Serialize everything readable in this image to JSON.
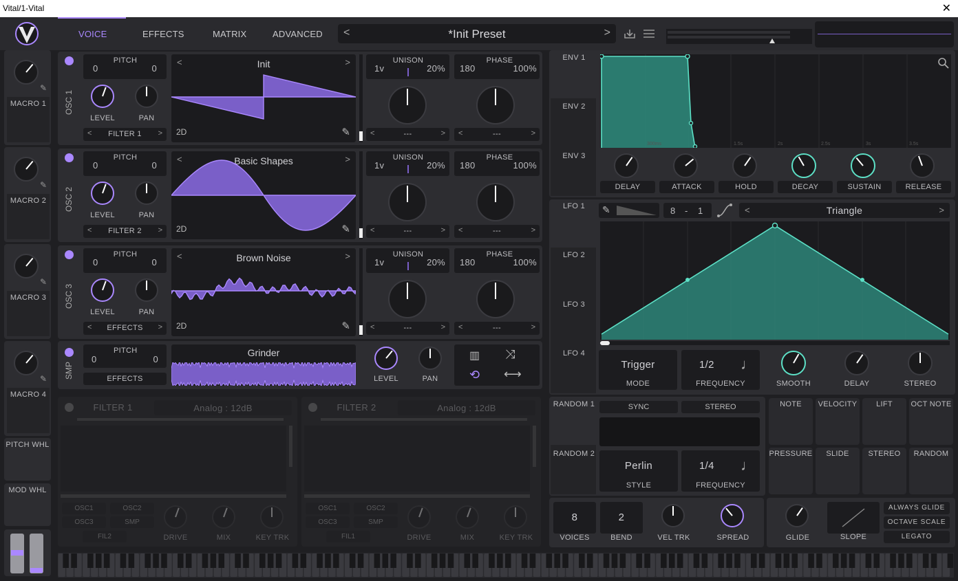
{
  "window": {
    "title": "Vital/1-Vital",
    "close": "✕"
  },
  "tabs": [
    "VOICE",
    "EFFECTS",
    "MATRIX",
    "ADVANCED"
  ],
  "preset": {
    "name": "*Init Preset",
    "prev": "<",
    "next": ">"
  },
  "macros": [
    "MACRO 1",
    "MACRO 2",
    "MACRO 3",
    "MACRO 4"
  ],
  "wheels": [
    "PITCH WHL",
    "MOD WHL"
  ],
  "oscs": [
    {
      "title": "OSC 1",
      "pitch_label": "PITCH",
      "pitch_left": "0",
      "pitch_right": "0",
      "level": "LEVEL",
      "pan": "PAN",
      "route": "FILTER 1",
      "wave": "Init",
      "mode": "2D",
      "unison": "UNISON",
      "voices": "1v",
      "detune": "20%",
      "phase_lbl": "PHASE",
      "phase": "180",
      "rand": "100%",
      "sel_a": "---",
      "sel_b": "---"
    },
    {
      "title": "OSC 2",
      "pitch_label": "PITCH",
      "pitch_left": "0",
      "pitch_right": "0",
      "level": "LEVEL",
      "pan": "PAN",
      "route": "FILTER 2",
      "wave": "Basic Shapes",
      "mode": "2D",
      "unison": "UNISON",
      "voices": "1v",
      "detune": "20%",
      "phase_lbl": "PHASE",
      "phase": "180",
      "rand": "100%",
      "sel_a": "---",
      "sel_b": "---"
    },
    {
      "title": "OSC 3",
      "pitch_label": "PITCH",
      "pitch_left": "0",
      "pitch_right": "0",
      "level": "LEVEL",
      "pan": "PAN",
      "route": "EFFECTS",
      "wave": "Brown Noise",
      "mode": "2D",
      "unison": "UNISON",
      "voices": "1v",
      "detune": "20%",
      "phase_lbl": "PHASE",
      "phase": "180",
      "rand": "100%",
      "sel_a": "---",
      "sel_b": "---"
    }
  ],
  "smp": {
    "title": "SMP",
    "pitch_label": "PITCH",
    "pitch_left": "0",
    "pitch_right": "0",
    "route": "EFFECTS",
    "wave": "Grinder",
    "level": "LEVEL",
    "pan": "PAN"
  },
  "filters": [
    {
      "title": "FILTER 1",
      "type": "Analog : 12dB",
      "src": [
        "OSC1",
        "OSC2",
        "OSC3",
        "SMP",
        "FIL2"
      ],
      "drive": "DRIVE",
      "mix": "MIX",
      "keytrk": "KEY TRK"
    },
    {
      "title": "FILTER 2",
      "type": "Analog : 12dB",
      "src": [
        "OSC1",
        "OSC2",
        "OSC3",
        "SMP",
        "FIL1"
      ],
      "drive": "DRIVE",
      "mix": "MIX",
      "keytrk": "KEY TRK"
    }
  ],
  "envs": [
    "ENV 1",
    "ENV 2",
    "ENV 3"
  ],
  "env_time": [
    "300ms",
    "1.5s",
    "2s",
    "2.5s",
    "3s",
    "3.5s"
  ],
  "env_knobs": [
    "DELAY",
    "ATTACK",
    "HOLD",
    "DECAY",
    "SUSTAIN",
    "RELEASE"
  ],
  "lfos": [
    "LFO 1",
    "LFO 2",
    "LFO 3",
    "LFO 4"
  ],
  "lfo": {
    "rate_a": "8",
    "rate_sep": "-",
    "rate_b": "1",
    "shape": "Triangle",
    "mode_val": "Trigger",
    "mode": "MODE",
    "freq_val": "1/2",
    "freq": "FREQUENCY",
    "smooth": "SMOOTH",
    "delay": "DELAY",
    "stereo": "STEREO"
  },
  "randoms": [
    "RANDOM 1",
    "RANDOM 2"
  ],
  "random": {
    "sync": "SYNC",
    "stereo": "STEREO",
    "style_val": "Perlin",
    "style": "STYLE",
    "freq_val": "1/4",
    "freq": "FREQUENCY"
  },
  "mods": [
    "NOTE",
    "VELOCITY",
    "LIFT",
    "OCT NOTE",
    "PRESSURE",
    "SLIDE",
    "STEREO",
    "RANDOM"
  ],
  "voice": {
    "voices_val": "8",
    "voices": "VOICES",
    "bend_val": "2",
    "bend": "BEND",
    "veltrk": "VEL TRK",
    "spread": "SPREAD"
  },
  "glide": {
    "glide": "GLIDE",
    "slope": "SLOPE",
    "always": "ALWAYS GLIDE",
    "octave": "OCTAVE SCALE",
    "legato": "LEGATO"
  },
  "colors": {
    "accent": "#aa88ff",
    "teal": "#5de0c6"
  }
}
